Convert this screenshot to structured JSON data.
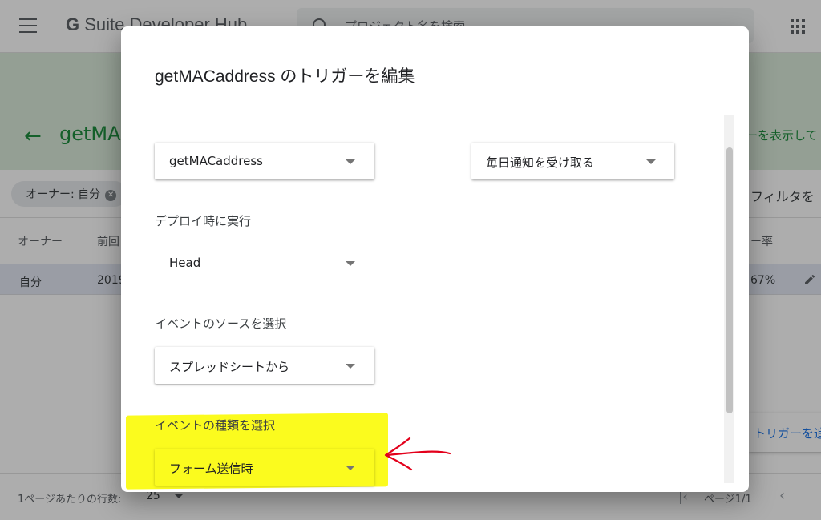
{
  "background": {
    "logo": {
      "g": "G",
      "text": "Suite Developer Hub"
    },
    "search": {
      "placeholder": "プロジェクト名を検索"
    },
    "project_title": "getMAC",
    "right_link": "ーを表示して",
    "filter_chip": "オーナー: 自分",
    "filter_text": "フィルタを",
    "table": {
      "headers": {
        "owner": "オーナー",
        "last": "前回",
        "rate": "ー率"
      },
      "row": {
        "owner": "自分",
        "date": "2019",
        "rate": "67%"
      }
    },
    "add_trigger": "トリガーを追",
    "footer": {
      "rows_label": "1ページあたりの行数:",
      "rows_value": "25",
      "page_label": "ページ1/1"
    }
  },
  "dialog": {
    "title": "getMACaddress のトリガーを編集",
    "function_select": "getMACaddress",
    "deploy_label": "デプロイ時に実行",
    "deploy_value": "Head",
    "source_label": "イベントのソースを選択",
    "source_value": "スプレッドシートから",
    "type_label": "イベントの種類を選択",
    "type_value": "フォーム送信時",
    "notify_select": "毎日通知を受け取る"
  },
  "colors": {
    "highlight": "#fbfb1e",
    "annotation_arrow": "#e3001b",
    "brand_green": "#1e8e3e"
  }
}
